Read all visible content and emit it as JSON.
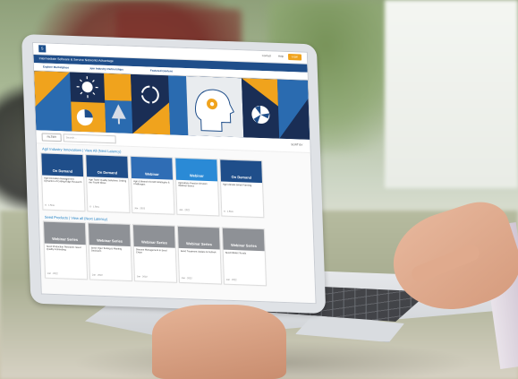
{
  "site": {
    "logo": "S",
    "top_links": [
      "Contact",
      "Help",
      "Login"
    ],
    "nav_title": "Intermediate Software & Service Networks Advantage",
    "tabs": [
      "Explore Marketplace",
      "Join Industry Partnerships",
      "Featured Content"
    ]
  },
  "filter": {
    "button_label": "FILTER",
    "search_placeholder": "Search...",
    "sort_label": "SORT BY"
  },
  "sections": [
    {
      "title": "Agri Industry Innovations | View All (Next Latency)",
      "cards": [
        {
          "badge": "On Demand",
          "desc": "Agri Innovation Management: Dynamics of Cutting-Edge Research",
          "meta": "6 · 1.5hrs",
          "color": "#1f4e8a"
        },
        {
          "badge": "On Demand",
          "desc": "Agri Tower Quality Solutions: Driving the Fourth Wave",
          "meta": "6 · 1.5hrs",
          "color": "#1f4e8a"
        },
        {
          "badge": "Webinar",
          "desc": "Agri & Biotech Growth Strategies & Challenges",
          "meta": "Jan · 2022",
          "color": "#2f6db5"
        },
        {
          "badge": "Webinar",
          "desc": "Agriculture Practice Session Webinar Series",
          "meta": "Jan · 2022",
          "color": "#2a8ad6"
        },
        {
          "badge": "On Demand",
          "desc": "Agri Climate Smart Farming",
          "meta": "6 · 1.5hrs",
          "color": "#1f4e8a"
        }
      ]
    },
    {
      "title": "Seed Products | View all (Next Latency)",
      "cards": [
        {
          "badge": "Webinar Series",
          "desc": "Seed Production Research: Seed Quality & Breeding",
          "meta": "Jan · 2022",
          "color": "#8e9196"
        },
        {
          "badge": "Webinar Series",
          "desc": "Seed Vigor Testing & Planting Decisions",
          "meta": "Jan · 2022",
          "color": "#8e9196"
        },
        {
          "badge": "Webinar Series",
          "desc": "Disease Management in Seed Crops",
          "meta": "Jan · 2022",
          "color": "#8e9196"
        },
        {
          "badge": "Webinar Series",
          "desc": "Seed Treatment Update & Outlook",
          "meta": "Jan · 2022",
          "color": "#8e9196"
        },
        {
          "badge": "Webinar Series",
          "desc": "Seed Market Trends",
          "meta": "Jan · 2022",
          "color": "#8e9196"
        }
      ]
    }
  ],
  "colors": {
    "brand_blue": "#1f4e8a",
    "accent_yellow": "#f0a31d",
    "link_blue": "#1d7fc4"
  },
  "icons": [
    "sun-icon",
    "recycle-icon",
    "head-gear-icon",
    "fan-icon",
    "pie-chart-icon",
    "tree-icon"
  ]
}
